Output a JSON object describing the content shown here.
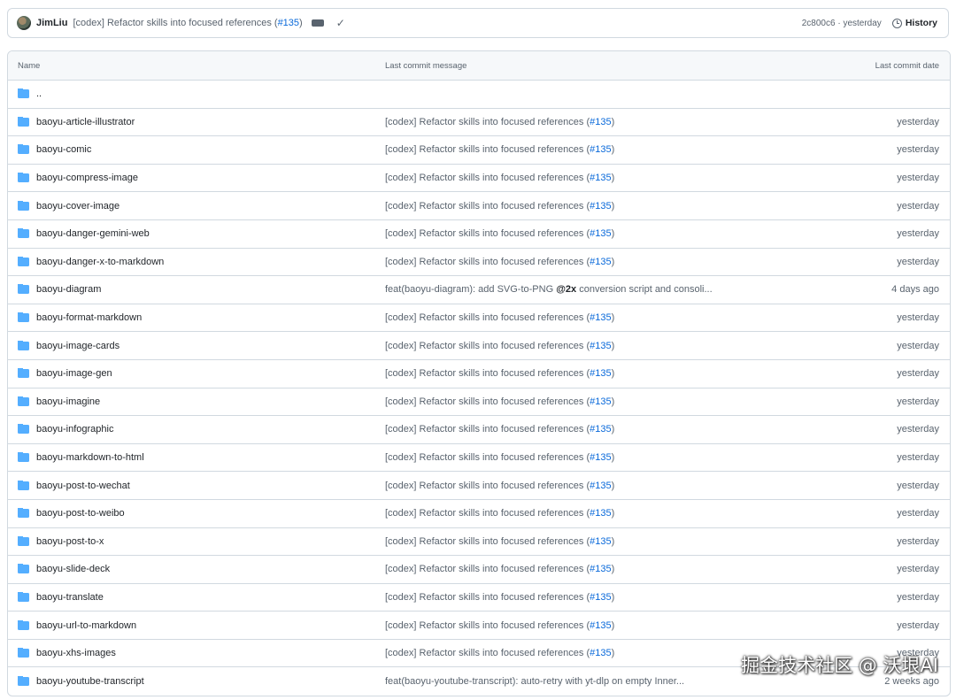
{
  "commit_bar": {
    "author": "JimLiu",
    "message_prefix": "[codex] Refactor skills into focused references (",
    "pr": "#135",
    "message_suffix": ")",
    "sha_time": "2c800c6 · yesterday",
    "history_label": "History"
  },
  "table": {
    "headers": {
      "name": "Name",
      "message": "Last commit message",
      "date": "Last commit date"
    },
    "parent_dir": "..",
    "rows": [
      {
        "name": "baoyu-article-illustrator",
        "msg_pre": "[codex] Refactor skills into focused references (",
        "pr": "#135",
        "msg_post": ")",
        "bold": "",
        "msg_tail": "",
        "date": "yesterday"
      },
      {
        "name": "baoyu-comic",
        "msg_pre": "[codex] Refactor skills into focused references (",
        "pr": "#135",
        "msg_post": ")",
        "bold": "",
        "msg_tail": "",
        "date": "yesterday"
      },
      {
        "name": "baoyu-compress-image",
        "msg_pre": "[codex] Refactor skills into focused references (",
        "pr": "#135",
        "msg_post": ")",
        "bold": "",
        "msg_tail": "",
        "date": "yesterday"
      },
      {
        "name": "baoyu-cover-image",
        "msg_pre": "[codex] Refactor skills into focused references (",
        "pr": "#135",
        "msg_post": ")",
        "bold": "",
        "msg_tail": "",
        "date": "yesterday"
      },
      {
        "name": "baoyu-danger-gemini-web",
        "msg_pre": "[codex] Refactor skills into focused references (",
        "pr": "#135",
        "msg_post": ")",
        "bold": "",
        "msg_tail": "",
        "date": "yesterday"
      },
      {
        "name": "baoyu-danger-x-to-markdown",
        "msg_pre": "[codex] Refactor skills into focused references (",
        "pr": "#135",
        "msg_post": ")",
        "bold": "",
        "msg_tail": "",
        "date": "yesterday"
      },
      {
        "name": "baoyu-diagram",
        "msg_pre": "feat(baoyu-diagram): add SVG-to-PNG ",
        "pr": "",
        "msg_post": "",
        "bold": "@2x",
        "msg_tail": " conversion script and consoli...",
        "date": "4 days ago"
      },
      {
        "name": "baoyu-format-markdown",
        "msg_pre": "[codex] Refactor skills into focused references (",
        "pr": "#135",
        "msg_post": ")",
        "bold": "",
        "msg_tail": "",
        "date": "yesterday"
      },
      {
        "name": "baoyu-image-cards",
        "msg_pre": "[codex] Refactor skills into focused references (",
        "pr": "#135",
        "msg_post": ")",
        "bold": "",
        "msg_tail": "",
        "date": "yesterday"
      },
      {
        "name": "baoyu-image-gen",
        "msg_pre": "[codex] Refactor skills into focused references (",
        "pr": "#135",
        "msg_post": ")",
        "bold": "",
        "msg_tail": "",
        "date": "yesterday"
      },
      {
        "name": "baoyu-imagine",
        "msg_pre": "[codex] Refactor skills into focused references (",
        "pr": "#135",
        "msg_post": ")",
        "bold": "",
        "msg_tail": "",
        "date": "yesterday"
      },
      {
        "name": "baoyu-infographic",
        "msg_pre": "[codex] Refactor skills into focused references (",
        "pr": "#135",
        "msg_post": ")",
        "bold": "",
        "msg_tail": "",
        "date": "yesterday"
      },
      {
        "name": "baoyu-markdown-to-html",
        "msg_pre": "[codex] Refactor skills into focused references (",
        "pr": "#135",
        "msg_post": ")",
        "bold": "",
        "msg_tail": "",
        "date": "yesterday"
      },
      {
        "name": "baoyu-post-to-wechat",
        "msg_pre": "[codex] Refactor skills into focused references (",
        "pr": "#135",
        "msg_post": ")",
        "bold": "",
        "msg_tail": "",
        "date": "yesterday"
      },
      {
        "name": "baoyu-post-to-weibo",
        "msg_pre": "[codex] Refactor skills into focused references (",
        "pr": "#135",
        "msg_post": ")",
        "bold": "",
        "msg_tail": "",
        "date": "yesterday"
      },
      {
        "name": "baoyu-post-to-x",
        "msg_pre": "[codex] Refactor skills into focused references (",
        "pr": "#135",
        "msg_post": ")",
        "bold": "",
        "msg_tail": "",
        "date": "yesterday"
      },
      {
        "name": "baoyu-slide-deck",
        "msg_pre": "[codex] Refactor skills into focused references (",
        "pr": "#135",
        "msg_post": ")",
        "bold": "",
        "msg_tail": "",
        "date": "yesterday"
      },
      {
        "name": "baoyu-translate",
        "msg_pre": "[codex] Refactor skills into focused references (",
        "pr": "#135",
        "msg_post": ")",
        "bold": "",
        "msg_tail": "",
        "date": "yesterday"
      },
      {
        "name": "baoyu-url-to-markdown",
        "msg_pre": "[codex] Refactor skills into focused references (",
        "pr": "#135",
        "msg_post": ")",
        "bold": "",
        "msg_tail": "",
        "date": "yesterday"
      },
      {
        "name": "baoyu-xhs-images",
        "msg_pre": "[codex] Refactor skills into focused references (",
        "pr": "#135",
        "msg_post": ")",
        "bold": "",
        "msg_tail": "",
        "date": "yesterday"
      },
      {
        "name": "baoyu-youtube-transcript",
        "msg_pre": "feat(baoyu-youtube-transcript): auto-retry with yt-dlp on empty Inner...",
        "pr": "",
        "msg_post": "",
        "bold": "",
        "msg_tail": "",
        "date": "2 weeks ago"
      }
    ]
  },
  "watermark": "掘金技术社区 @ 沃垠AI",
  "icons": {
    "folder": "folder-icon",
    "history": "history-icon",
    "check": "check-icon",
    "ellipsis": "ellipsis-icon"
  },
  "colors": {
    "link": "#0969da",
    "folder": "#54aeff",
    "muted_text": "#59636e",
    "border": "#d1d9e0",
    "header_bg": "#f6f8fa"
  }
}
